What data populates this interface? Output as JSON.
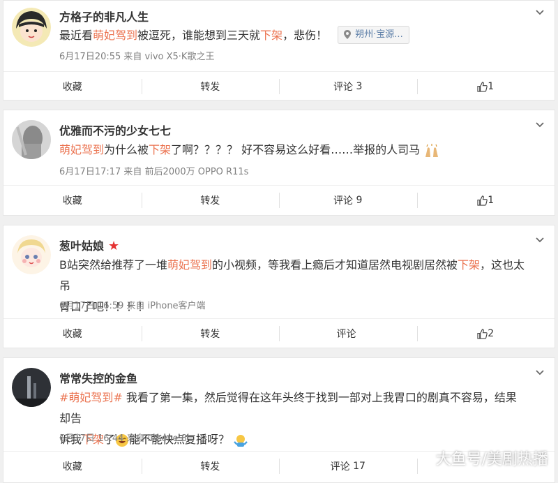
{
  "action_labels": {
    "collect": "收藏",
    "repost": "转发",
    "comment": "评论"
  },
  "posts": [
    {
      "username": "方格子的非凡人生",
      "text_parts": [
        "最近看",
        "萌妃驾到",
        "被逗死，谁能想到三天就",
        "下架",
        "，悲伤！"
      ],
      "location": "朔州·宝源...",
      "meta": "6月17日20:55 来自 vivo X5·K歌之王",
      "comment_count": "3",
      "like_count": "1"
    },
    {
      "username": "优雅而不污的少女七七",
      "text_parts": [
        "萌妃驾到",
        "为什么被",
        "下架",
        "了啊？？？？ 好不容易这么好看……举报的人司马"
      ],
      "meta": "6月17日17:17 来自 前后2000万 OPPO R11s",
      "comment_count": "9",
      "like_count": "1"
    },
    {
      "username": "葱叶姑娘",
      "text_parts": [
        "B站突然给推荐了一堆",
        "萌妃驾到",
        "的小视频，等我看上瘾后才知道居然电视剧居然被",
        "下架",
        "，这也太吊",
        "胃口了吧！！！！"
      ],
      "meta": "6月17日 16:59 来自 iPhone客户端",
      "comment_count": "",
      "like_count": "2"
    },
    {
      "username": "常常失控的金鱼",
      "text_parts": [
        "#萌妃驾到#",
        " 我看了第一集，然后觉得在这年头终于找到一部对上我胃口的剧真不容易，结果却告",
        "诉我",
        "下架",
        "了",
        "能不能快点复播呀？"
      ],
      "meta": "6月17日 16:44 来自 iPhone 8",
      "comment_count": "17",
      "like_count": ""
    }
  ],
  "watermark": "大鱼号/美剧热播",
  "colors": {
    "highlight": "#eb7350",
    "location_text": "#5d7fa8",
    "vip_star": "#e53333"
  }
}
